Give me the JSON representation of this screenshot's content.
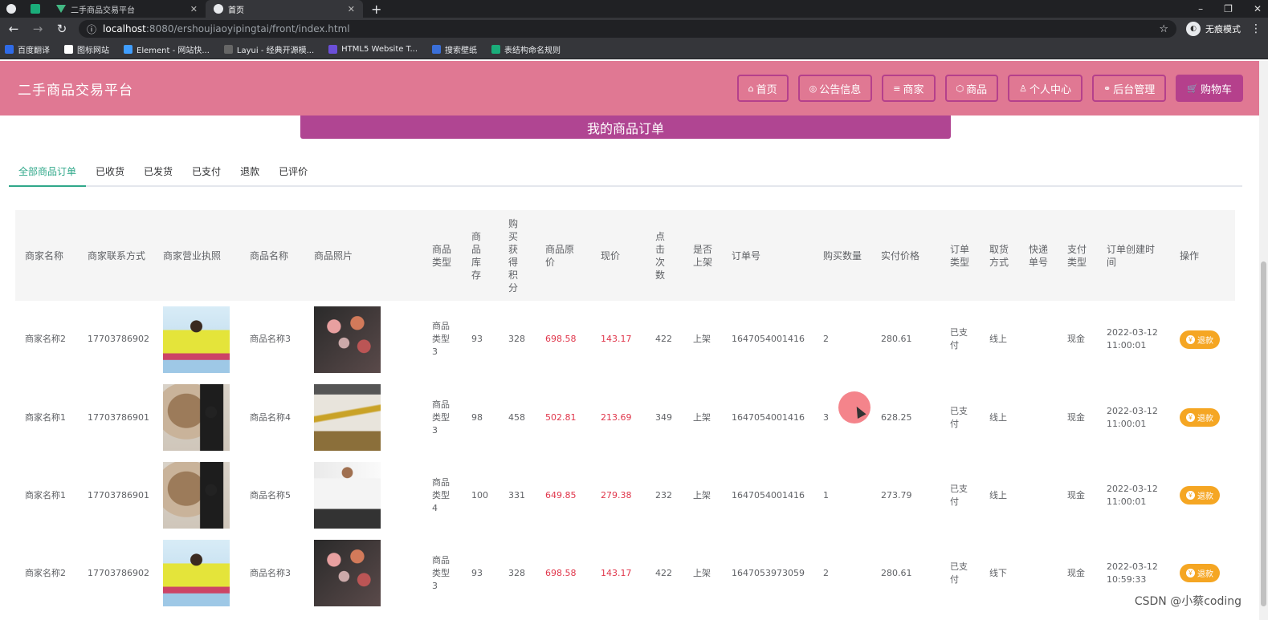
{
  "browser": {
    "tabs": [
      {
        "title": "",
        "favicon": "globe-icon"
      },
      {
        "title": "",
        "favicon": "sheet-icon"
      },
      {
        "title": "二手商品交易平台",
        "favicon": "vue-icon"
      },
      {
        "title": "首页",
        "favicon": "globe-icon",
        "active": true
      }
    ],
    "new_tab": "+",
    "window_controls": [
      "–",
      "❐",
      "✕"
    ],
    "url_host": "localhost",
    "url_path": ":8080/ershoujiaoyipingtai/front/index.html",
    "incognito_label": "无痕模式",
    "bookmarks": [
      {
        "label": "百度翻译",
        "color": "#2f6be8"
      },
      {
        "label": "图标网站",
        "color": "#ffffff"
      },
      {
        "label": "Element - 网站快...",
        "color": "#409eff"
      },
      {
        "label": "Layui - 经典开源模...",
        "color": "#666666"
      },
      {
        "label": "HTML5 Website T...",
        "color": "#6b4fd8"
      },
      {
        "label": "搜索壁纸",
        "color": "#3a6fd8"
      },
      {
        "label": "表结构命名规则",
        "color": "#1aad7a"
      }
    ]
  },
  "header": {
    "title": "二手商品交易平台",
    "nav": [
      {
        "label": "首页",
        "icon": "home-icon",
        "glyph": "⌂"
      },
      {
        "label": "公告信息",
        "icon": "bell-icon",
        "glyph": "◎"
      },
      {
        "label": "商家",
        "icon": "shop-icon",
        "glyph": "≡"
      },
      {
        "label": "商品",
        "icon": "box-icon",
        "glyph": "⬡"
      },
      {
        "label": "个人中心",
        "icon": "user-icon",
        "glyph": "♙"
      },
      {
        "label": "后台管理",
        "icon": "link-icon",
        "glyph": "⚭"
      },
      {
        "label": "购物车",
        "icon": "cart-icon",
        "glyph": "🛒"
      }
    ]
  },
  "banner": {
    "title": "我的商品订单"
  },
  "order_tabs": [
    "全部商品订单",
    "已收货",
    "已发货",
    "已支付",
    "退款",
    "已评价"
  ],
  "table": {
    "columns": [
      "商家名称",
      "商家联系方式",
      "商家营业执照",
      "商品名称",
      "商品照片",
      "商品类型",
      "商品库存",
      "购买获得积分",
      "商品原价",
      "现价",
      "点击次数",
      "是否上架",
      "订单号",
      "购买数量",
      "实付价格",
      "订单类型",
      "取货方式",
      "快递单号",
      "支付类型",
      "订单创建时间",
      "操作"
    ],
    "rows": [
      {
        "merchant": "商家名称2",
        "phone": "17703786902",
        "license_img": "girl-yellow",
        "product": "商品名称3",
        "photo_img": "cosmetics",
        "type": "商品类型3",
        "stock": "93",
        "points": "328",
        "orig_price": "698.58",
        "price": "143.17",
        "clicks": "422",
        "listed": "上架",
        "order_no": "1647054001416",
        "qty": "2",
        "paid": "280.61",
        "order_type": "已支付",
        "pickup": "线上",
        "express": "",
        "pay_type": "现金",
        "created": "2022-03-12 11:00:01",
        "action": "退款"
      },
      {
        "merchant": "商家名称1",
        "phone": "17703786901",
        "license_img": "painting-man",
        "product": "商品名称4",
        "photo_img": "necklace",
        "type": "商品类型3",
        "stock": "98",
        "points": "458",
        "orig_price": "502.81",
        "price": "213.69",
        "clicks": "349",
        "listed": "上架",
        "order_no": "1647054001416",
        "qty": "3",
        "paid": "628.25",
        "order_type": "已支付",
        "pickup": "线上",
        "express": "",
        "pay_type": "现金",
        "created": "2022-03-12 11:00:01",
        "action": "退款"
      },
      {
        "merchant": "商家名称1",
        "phone": "17703786901",
        "license_img": "painting-man",
        "product": "商品名称5",
        "photo_img": "white-shirt",
        "type": "商品类型4",
        "stock": "100",
        "points": "331",
        "orig_price": "649.85",
        "price": "279.38",
        "clicks": "232",
        "listed": "上架",
        "order_no": "1647054001416",
        "qty": "1",
        "paid": "273.79",
        "order_type": "已支付",
        "pickup": "线上",
        "express": "",
        "pay_type": "现金",
        "created": "2022-03-12 11:00:01",
        "action": "退款"
      },
      {
        "merchant": "商家名称2",
        "phone": "17703786902",
        "license_img": "girl-yellow",
        "product": "商品名称3",
        "photo_img": "cosmetics",
        "type": "商品类型3",
        "stock": "93",
        "points": "328",
        "orig_price": "698.58",
        "price": "143.17",
        "clicks": "422",
        "listed": "上架",
        "order_no": "1647053973059",
        "qty": "2",
        "paid": "280.61",
        "order_type": "已支付",
        "pickup": "线下",
        "express": "",
        "pay_type": "现金",
        "created": "2022-03-12 10:59:33",
        "action": "退款"
      }
    ]
  },
  "watermark": "CSDN @小蔡coding",
  "colors": {
    "header_bg": "#e07893",
    "accent": "#b5408c",
    "banner": "#b04592",
    "price_red": "#e0364b",
    "refund": "#f5a623",
    "active_tab": "#30a88a"
  }
}
